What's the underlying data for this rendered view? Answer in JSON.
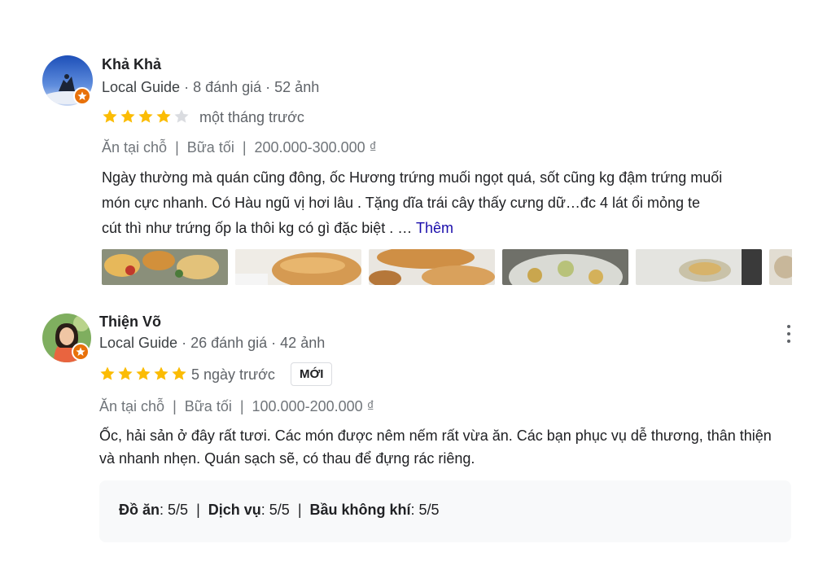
{
  "reviews": [
    {
      "name": "Khả Khả",
      "guide_label": "Local Guide",
      "stats": "· 8 đánh giá · 52 ảnh",
      "rating": 4,
      "date": "một tháng trước",
      "tags": [
        "Ăn tại chỗ",
        "Bữa tối",
        "200.000-300.000 ₫"
      ],
      "text_lines": [
        "Ngày thường mà quán cũng đông, ốc Hương trứng muối ngọt quá, sốt cũng kg đậm trứng muối",
        "món cực nhanh. Có Hàu ngũ vị hơi lâu . Tặng dĩa trái cây thấy cưng dữ…đc 4 lát ổi mỏng te",
        "cút thì như trứng ốp la thôi kg có gì đặc biệt . …"
      ],
      "more_label": "Thêm",
      "photos": [
        "photo-1",
        "photo-2",
        "photo-3",
        "photo-4",
        "photo-5",
        "photo-6"
      ]
    },
    {
      "name": "Thiện Võ",
      "guide_label": "Local Guide",
      "stats": "· 26 đánh giá · 42 ảnh",
      "rating": 5,
      "date": "5 ngày trước",
      "new_badge": "MỚI",
      "tags": [
        "Ăn tại chỗ",
        "Bữa tối",
        "100.000-200.000 ₫"
      ],
      "text_lines": [
        "Ốc, hải sản ở đây rất tươi. Các món được nêm nếm rất vừa ăn. Các bạn phục vụ dễ thương, thân thiện",
        "và nhanh nhẹn. Quán sạch sẽ, có thau để đựng rác riêng."
      ],
      "ratings": [
        {
          "label": "Đồ ăn",
          "value": "5/5"
        },
        {
          "label": "Dịch vụ",
          "value": "5/5"
        },
        {
          "label": "Bầu không khí",
          "value": "5/5"
        }
      ]
    }
  ],
  "colors": {
    "star_filled": "#fbbc04",
    "star_empty": "#dadce0",
    "link": "#1a0dab",
    "guide_badge": "#e8710a"
  }
}
